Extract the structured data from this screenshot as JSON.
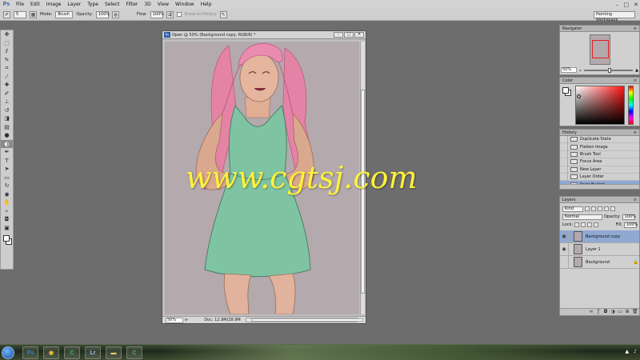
{
  "app": {
    "logo": "Ps",
    "menu": [
      "File",
      "Edit",
      "Image",
      "Layer",
      "Type",
      "Select",
      "Filter",
      "3D",
      "View",
      "Window",
      "Help"
    ],
    "window_controls": [
      "–",
      "□",
      "✕"
    ]
  },
  "options_bar": {
    "brush_size": "5",
    "mode_label": "Mode:",
    "mode_value": "Brush",
    "opacity_label": "Opacity:",
    "opacity_value": "100%",
    "flow_label": "Flow:",
    "flow_value": "100%",
    "erase_to_history": "Erase to History",
    "workspace": "Painting Workspace"
  },
  "toolbox": {
    "tools": [
      {
        "icon": "move-icon",
        "glyph": "✥"
      },
      {
        "icon": "marquee-icon",
        "glyph": "⬚"
      },
      {
        "icon": "lasso-icon",
        "glyph": "ℓ"
      },
      {
        "icon": "quick-select-icon",
        "glyph": "✎"
      },
      {
        "icon": "crop-icon",
        "glyph": "⌗"
      },
      {
        "icon": "eyedropper-icon",
        "glyph": "⁄"
      },
      {
        "icon": "healing-icon",
        "glyph": "✚"
      },
      {
        "icon": "brush-icon",
        "glyph": "✐"
      },
      {
        "icon": "clone-stamp-icon",
        "glyph": "⊥"
      },
      {
        "icon": "history-brush-icon",
        "glyph": "↺"
      },
      {
        "icon": "eraser-icon",
        "glyph": "◨"
      },
      {
        "icon": "gradient-icon",
        "glyph": "▤"
      },
      {
        "icon": "blur-icon",
        "glyph": "●"
      },
      {
        "icon": "dodge-icon",
        "glyph": "◐"
      },
      {
        "icon": "pen-icon",
        "glyph": "✒"
      },
      {
        "icon": "type-icon",
        "glyph": "T"
      },
      {
        "icon": "path-select-icon",
        "glyph": "➤"
      },
      {
        "icon": "shape-icon",
        "glyph": "▭"
      },
      {
        "icon": "3d-rotate-icon",
        "glyph": "↻"
      },
      {
        "icon": "3d-camera-icon",
        "glyph": "◉"
      },
      {
        "icon": "hand-icon",
        "glyph": "✋"
      },
      {
        "icon": "zoom-icon",
        "glyph": "⌕"
      },
      {
        "icon": "quick-mask-icon",
        "glyph": "◘"
      },
      {
        "icon": "screen-mode-icon",
        "glyph": "▣"
      }
    ],
    "active_index": 13,
    "fg_color": "#ffffff",
    "bg_color": "#ffffff"
  },
  "document": {
    "title": "Open @ 50% (Background copy, RGB/8) *",
    "zoom": "50%",
    "doc_info": "Doc: 12.9M/28.9M",
    "controls": [
      "–",
      "□",
      "✕"
    ]
  },
  "watermark": "www.cgtsj.com",
  "navigator": {
    "title": "Navigator",
    "zoom": "50%"
  },
  "color_panel": {
    "title": "Color"
  },
  "history": {
    "title": "History",
    "items": [
      "Duplicate State",
      "Flatten Image",
      "Brush Tool",
      "Focus Area",
      "New Layer",
      "Layer Order",
      "Paint Bucket"
    ],
    "selected_index": 6
  },
  "layers": {
    "title": "Layers",
    "kind_label": "Kind",
    "blend_mode": "Normal",
    "opacity_label": "Opacity:",
    "opacity_value": "100%",
    "lock_label": "Lock:",
    "fill_label": "Fill:",
    "fill_value": "100%",
    "items": [
      {
        "name": "Background copy",
        "visible": true,
        "selected": true
      },
      {
        "name": "Layer 1",
        "visible": true,
        "selected": false
      },
      {
        "name": "Background",
        "visible": false,
        "selected": false
      }
    ]
  },
  "taskbar": {
    "apps": [
      {
        "icon": "photoshop-icon",
        "glyph": "Ps",
        "color": "#2f7fe0"
      },
      {
        "icon": "chrome-icon",
        "glyph": "◉",
        "color": "#e8c13a"
      },
      {
        "icon": "camtasia-icon",
        "glyph": "C",
        "color": "#3ec25a"
      },
      {
        "icon": "lightroom-icon",
        "glyph": "Lr",
        "color": "#9ec1e6"
      },
      {
        "icon": "explorer-icon",
        "glyph": "▬",
        "color": "#e9cf72"
      },
      {
        "icon": "camtasia-recorder-icon",
        "glyph": "C",
        "color": "#3ec25a"
      }
    ]
  },
  "colors": {
    "canvas_bg": "#b4a9ac",
    "ui_gray": "#d0d0d0",
    "selection_blue": "#8fa9d2",
    "watermark_yellow": "#fff23a"
  }
}
